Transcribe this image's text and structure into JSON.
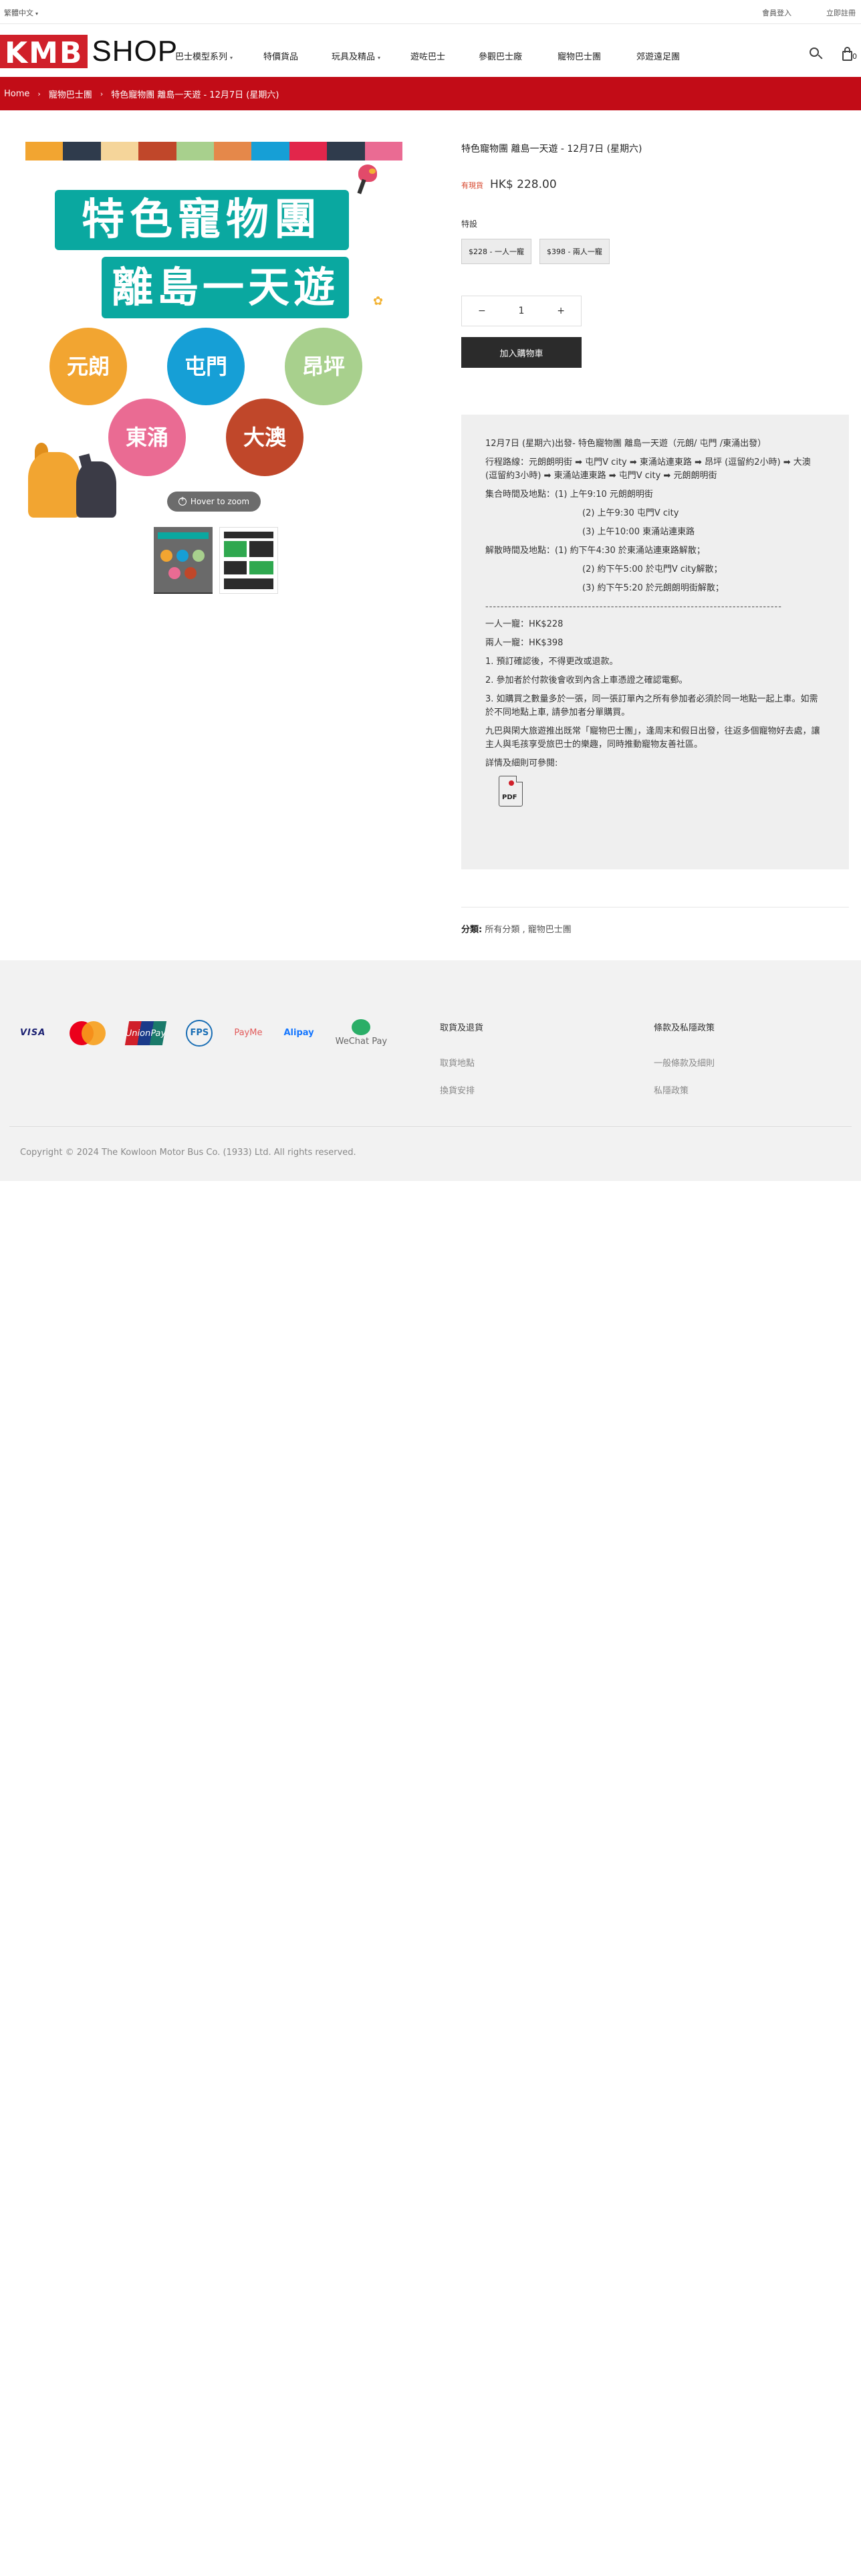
{
  "topbar": {
    "language": "繁體中文",
    "login": "會員登入",
    "register": "立即註冊"
  },
  "header": {
    "logo_kmb": "KMB",
    "logo_shop": "SHOP",
    "nav": [
      {
        "label": "巴士模型系列",
        "has_dropdown": true
      },
      {
        "label": "特價貨品",
        "has_dropdown": false
      },
      {
        "label": "玩具及精品",
        "has_dropdown": true
      },
      {
        "label": "遊咗巴士",
        "has_dropdown": false
      },
      {
        "label": "參觀巴士廠",
        "has_dropdown": false
      },
      {
        "label": "寵物巴士團",
        "has_dropdown": false
      },
      {
        "label": "郊遊遠足團",
        "has_dropdown": false
      }
    ],
    "cart_count": "0"
  },
  "breadcrumb": [
    "Home",
    "寵物巴士團",
    "特色寵物團 離島一天遊 - 12月7日 (星期六)"
  ],
  "gallery": {
    "stripe_colors": [
      "#f2a531",
      "#2f3b4c",
      "#f5d59a",
      "#c0472a",
      "#a8d08d",
      "#e5884a",
      "#169fd6",
      "#e2264b",
      "#2f3b4c",
      "#ea6b93"
    ],
    "poster_line1": "特色寵物團",
    "poster_line2": "離島一天遊",
    "locations": [
      {
        "name": "元朗",
        "color": "#f2a531"
      },
      {
        "name": "屯門",
        "color": "#169fd6"
      },
      {
        "name": "昂坪",
        "color": "#a8d08d"
      },
      {
        "name": "東涌",
        "color": "#ea6b93"
      },
      {
        "name": "大澳",
        "color": "#c0472a"
      }
    ],
    "zoom_label": "Hover to zoom"
  },
  "product": {
    "title": "特色寵物團 離島一天遊 - 12月7日 (星期六)",
    "sale_badge": "有現貨",
    "price": "HK$ 228.00",
    "option_label": "特設",
    "options": [
      "$228 - 一人一寵",
      "$398 - 兩人一寵"
    ],
    "quantity": "1",
    "qty_minus": "−",
    "qty_plus": "+",
    "add_to_cart": "加入購物車"
  },
  "description": {
    "heading": "12月7日 (星期六)出發- 特色寵物團  離島一天遊（元朗/ 屯門 /東涌出發）",
    "route": "行程路線：元朗朗明街 ➡ 屯門V city ➡ 東涌站連東路 ➡ 昂坪 (逗留約2小時) ➡ 大澳 (逗留約3小時) ➡ 東涌站連東路 ➡ 屯門V city ➡ 元朗朗明街",
    "meet_label": "集合時間及地點：",
    "meet": [
      "(1) 上午9:10  元朗朗明街",
      "(2) 上午9:30  屯門V city",
      "(3) 上午10:00  東涌站連東路"
    ],
    "dismiss_label": "解散時間及地點：",
    "dismiss": [
      "(1) 約下午4:30 於東涌站連東路解散；",
      "(2) 約下午5:00 於屯門V city解散；",
      "(3) 約下午5:20 於元朗朗明街解散；"
    ],
    "rule": "------------------------------------------------------------------------------",
    "price1": "一人一寵：HK$228",
    "price2": "兩人一寵：HK$398",
    "note1": "1. 預訂確認後，不得更改或退款。",
    "note2": "2. 參加者於付款後會收到內含上車憑證之確認電郵。",
    "note3": "3. 如購買之數量多於一張，同一張訂單內之所有參加者必須於同一地點一起上車。如需於不同地點上車, 請參加者分單購買。",
    "promo": "九巴與閑大旅遊推出既常「寵物巴士團」，逢周末和假日出發，往返多個寵物好去處，讓主人與毛孩享受旅巴士的樂趣，同時推動寵物友善社區。",
    "details": "詳情及細則可參閱:",
    "pdf_label": "PDF"
  },
  "category": {
    "label": "分類:",
    "value": "所有分類 , 寵物巴士團"
  },
  "footer": {
    "payments": [
      "VISA",
      "MasterCard",
      "UnionPay",
      "FPS",
      "PayMe",
      "Alipay",
      "WeChat Pay"
    ],
    "col1_title": "取貨及退貨",
    "col1_links": [
      "取貨地點",
      "換貨安排"
    ],
    "col2_title": "條款及私隱政策",
    "col2_links": [
      "一般條款及細則",
      "私隱政策"
    ],
    "copyright": "Copyright © 2024 The Kowloon Motor Bus Co. (1933) Ltd. All rights reserved."
  }
}
